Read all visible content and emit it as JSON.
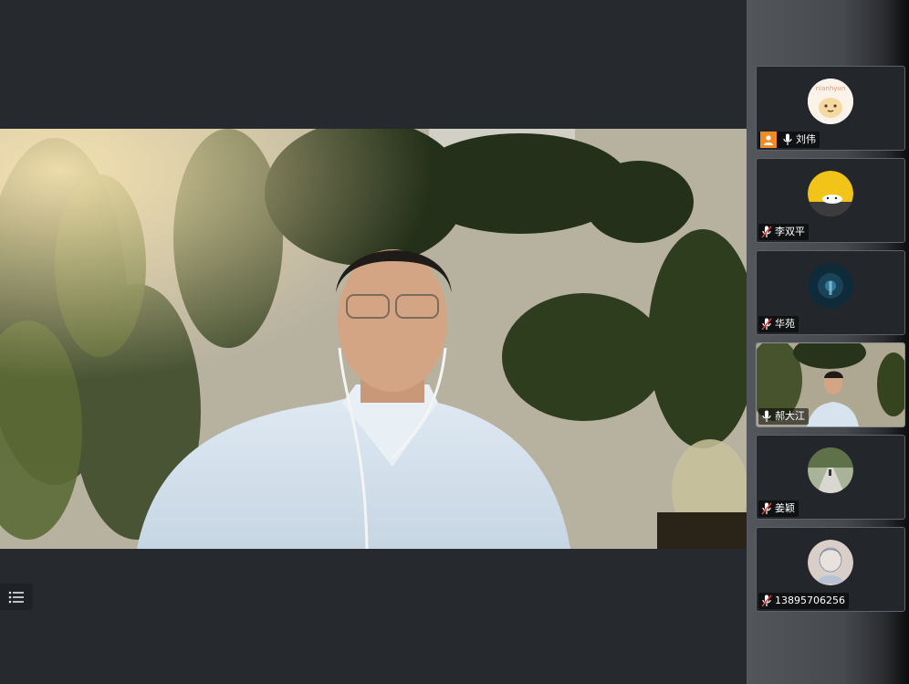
{
  "main_video": {
    "speaker_icon": "person-video",
    "alt": "active speaker video"
  },
  "toolbar": {
    "list_icon": "list-icon"
  },
  "participants": [
    {
      "name": "刘伟",
      "mic": "on",
      "host": true,
      "avatar_kind": "cartoon",
      "avatar_text": "nianhyun"
    },
    {
      "name": "李双平",
      "mic": "muted",
      "host": false,
      "avatar_kind": "yellow-emoji"
    },
    {
      "name": "华苑",
      "mic": "muted",
      "host": false,
      "avatar_kind": "dark-blue"
    },
    {
      "name": "郝大江",
      "mic": "on",
      "host": false,
      "avatar_kind": "video"
    },
    {
      "name": "姜颖",
      "mic": "muted",
      "host": false,
      "avatar_kind": "photo-path"
    },
    {
      "name": "13895706256",
      "mic": "muted",
      "host": false,
      "avatar_kind": "sketch"
    }
  ],
  "colors": {
    "background": "#26292e",
    "host_badge": "#f08a24",
    "muted_slash": "#e03a3a"
  }
}
